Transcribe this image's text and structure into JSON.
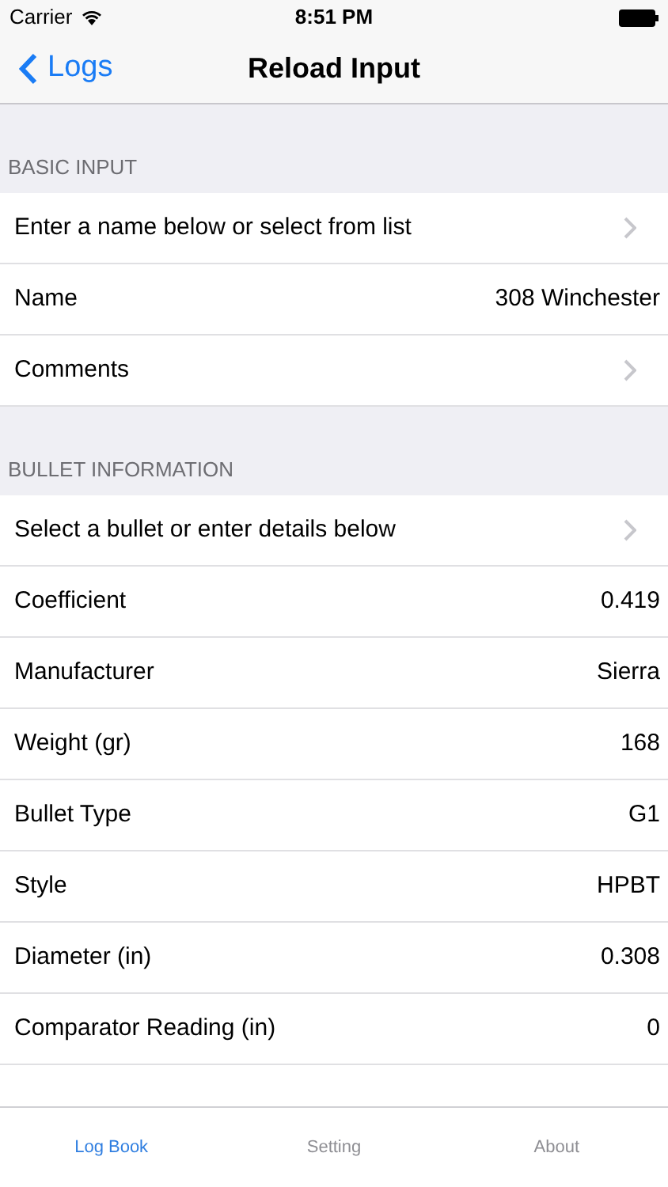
{
  "status_bar": {
    "carrier": "Carrier",
    "time": "8:51 PM"
  },
  "nav_bar": {
    "back": "Logs",
    "title": "Reload Input"
  },
  "sections": [
    {
      "header": "BASIC INPUT",
      "rows": [
        {
          "kind": "link",
          "label": "Enter a name below or select from list"
        },
        {
          "kind": "value",
          "label": "Name",
          "value": "308 Winchester"
        },
        {
          "kind": "link",
          "label": "Comments"
        }
      ]
    },
    {
      "header": "BULLET INFORMATION",
      "rows": [
        {
          "kind": "link",
          "label": "Select a bullet or enter details below"
        },
        {
          "kind": "value",
          "label": "Coefficient",
          "value": "0.419"
        },
        {
          "kind": "value",
          "label": "Manufacturer",
          "value": "Sierra"
        },
        {
          "kind": "value",
          "label": "Weight (gr)",
          "value": "168"
        },
        {
          "kind": "value",
          "label": "Bullet Type",
          "value": "G1"
        },
        {
          "kind": "value",
          "label": "Style",
          "value": "HPBT"
        },
        {
          "kind": "value",
          "label": "Diameter (in)",
          "value": "0.308"
        },
        {
          "kind": "value",
          "label": "Comparator Reading (in)",
          "value": "0"
        }
      ]
    }
  ],
  "tab_bar": [
    {
      "label": "Log Book",
      "selected": true
    },
    {
      "label": "Setting",
      "selected": false
    },
    {
      "label": "About",
      "selected": false
    }
  ]
}
